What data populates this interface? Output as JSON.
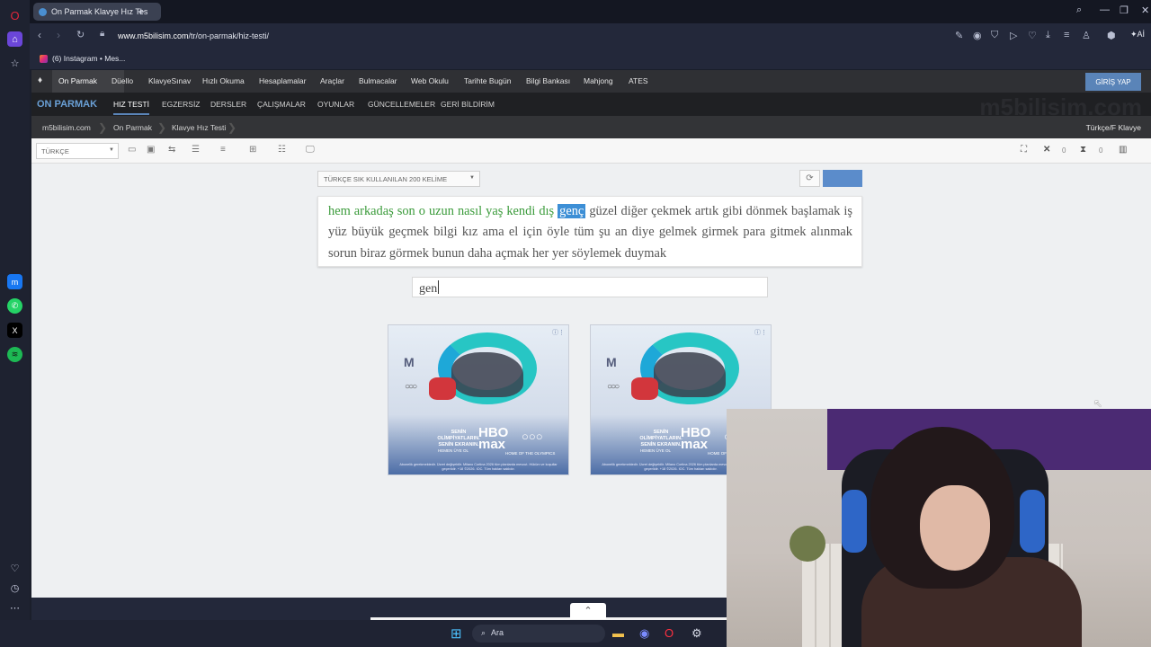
{
  "browser": {
    "tab_title": "On Parmak Klavye Hız Tes",
    "url_host": "www.m5bilisim.com",
    "url_path": "/tr/on-parmak/hiz-testi/",
    "bookmark": "(6) Instagram • Mes...",
    "ai_label": "Aİ"
  },
  "site": {
    "top_nav": [
      "On Parmak",
      "Düello",
      "KlavyeSınav",
      "Hızlı Okuma",
      "Hesaplamalar",
      "Araçlar",
      "Bulmacalar",
      "Web Okulu",
      "Tarihte Bugün",
      "Bilgi Bankası",
      "Mahjong",
      "ATES"
    ],
    "login_label": "GİRİŞ YAP",
    "brand": "ON PARMAK",
    "sub_nav": [
      "HIZ TESTİ",
      "EGZERSİZ",
      "DERSLER",
      "ÇALIŞMALAR",
      "OYUNLAR",
      "GÜNCELLEMELER",
      "GERİ BİLDİRİM"
    ],
    "watermark": "m5bilisim.com",
    "breadcrumb": [
      "m5bilisim.com",
      "On Parmak",
      "Klavye Hız Testi"
    ],
    "keyboard_layout": "Türkçe/F Klavye",
    "language_select": "TÜRKÇE",
    "error_count": "0",
    "time_count": "0"
  },
  "test": {
    "word_set": "TÜRKÇE SIK KULLANILAN 200 KELİME",
    "typed_words": "hem arkadaş son o uzun nasıl yaş kendi dış",
    "current_word": "genç",
    "remaining_words": "güzel diğer çekmek artık gibi dönmek başlamak iş yüz büyük geçmek bilgi kız ama el için öyle tüm şu an diye gelmek girmek para gitmek alınmak sorun biraz görmek bunun daha açmak her yer söylemek duymak",
    "input_value": "gen"
  },
  "ad": {
    "brand": "max",
    "hbo": "HBO",
    "tagline": "SENİN OLİMPİYATLARIN. SENİN EKRANIN.",
    "cta": "HEMEN ÜYE OL",
    "home": "HOME OF THE OLYMPICS",
    "legal": "Abonelik gerekmektedir. Ücret değişebilir. Milano Cortina 2026 tüm planlarda mevcut. Hüküm ve koşullar geçerlidir. +18 ©2026. IOC. Tüm hakları saklıdır."
  },
  "taskbar": {
    "search_placeholder": "Ara"
  }
}
